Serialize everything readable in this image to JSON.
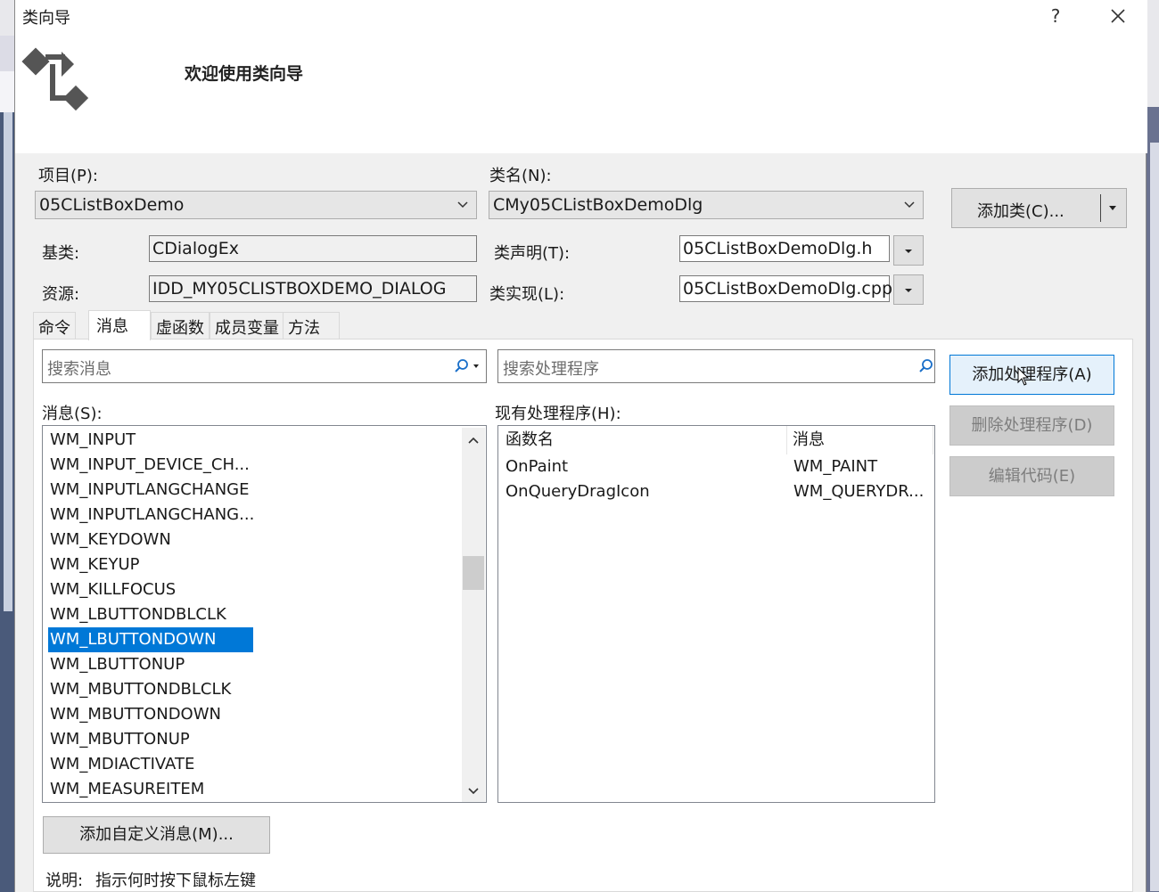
{
  "dialog": {
    "title": "类向导",
    "help_label": "?",
    "welcome_text": "欢迎使用类向导"
  },
  "project": {
    "label": "项目(P):",
    "value": "05CListBoxDemo"
  },
  "classname": {
    "label": "类名(N):",
    "value": "CMy05CListBoxDemoDlg"
  },
  "add_class_button": "添加类(C)...",
  "base_class": {
    "label": "基类:",
    "value": "CDialogEx"
  },
  "resource": {
    "label": "资源:",
    "value": "IDD_MY05CLISTBOXDEMO_DIALOG"
  },
  "class_declaration": {
    "label": "类声明(T):",
    "value": "05CListBoxDemoDlg.h"
  },
  "class_implementation": {
    "label": "类实现(L):",
    "value": "05CListBoxDemoDlg.cpp"
  },
  "tabs": [
    {
      "label": "命令",
      "active": false
    },
    {
      "label": "消息",
      "active": true
    },
    {
      "label": "虚函数",
      "active": false
    },
    {
      "label": "成员变量",
      "active": false
    },
    {
      "label": "方法",
      "active": false
    }
  ],
  "search_messages": {
    "placeholder": "搜索消息"
  },
  "search_handlers": {
    "placeholder": "搜索处理程序"
  },
  "messages": {
    "label": "消息(S):",
    "items": [
      "WM_INPUT",
      "WM_INPUT_DEVICE_CH...",
      "WM_INPUTLANGCHANGE",
      "WM_INPUTLANGCHANG...",
      "WM_KEYDOWN",
      "WM_KEYUP",
      "WM_KILLFOCUS",
      "WM_LBUTTONDBLCLK",
      "WM_LBUTTONDOWN",
      "WM_LBUTTONUP",
      "WM_MBUTTONDBLCLK",
      "WM_MBUTTONDOWN",
      "WM_MBUTTONUP",
      "WM_MDIACTIVATE",
      "WM_MEASUREITEM"
    ],
    "selected": "WM_LBUTTONDOWN"
  },
  "handlers": {
    "label": "现有处理程序(H):",
    "columns": [
      "函数名",
      "消息"
    ],
    "rows": [
      [
        "OnPaint",
        "WM_PAINT"
      ],
      [
        "OnQueryDragIcon",
        "WM_QUERYDR..."
      ]
    ]
  },
  "buttons": {
    "add_handler": "添加处理程序(A)",
    "delete_handler": "删除处理程序(D)",
    "edit_code": "编辑代码(E)",
    "add_custom_message": "添加自定义消息(M)..."
  },
  "description": {
    "label": "说明:",
    "text": "指示何时按下鼠标左键"
  }
}
